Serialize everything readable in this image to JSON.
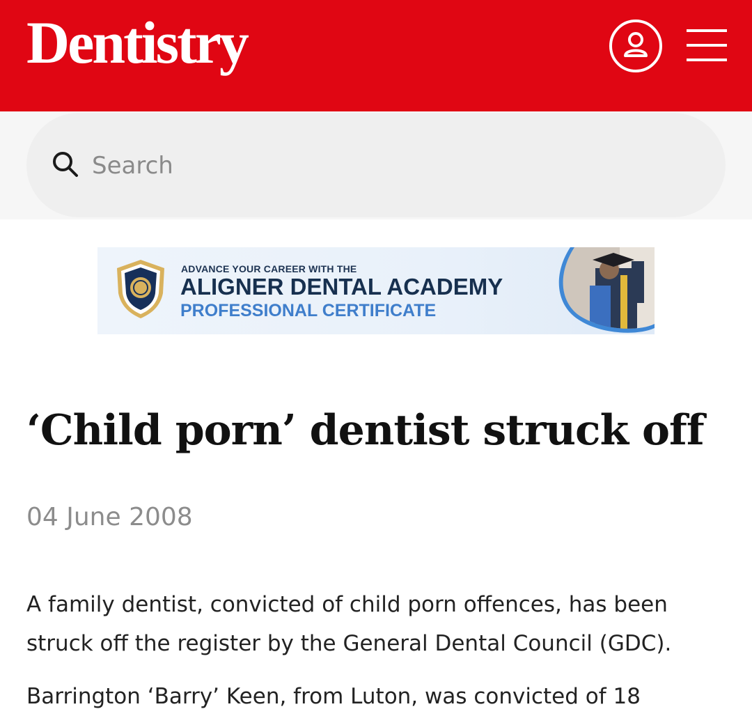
{
  "header": {
    "logo_text": "Dentistry",
    "brand_color": "#e00613",
    "account_icon": "user-icon",
    "menu_icon": "hamburger-menu-icon"
  },
  "search": {
    "placeholder": "Search",
    "icon": "search-icon"
  },
  "banner": {
    "line1": "ADVANCE YOUR CAREER WITH THE",
    "line2": "ALIGNER DENTAL ACADEMY",
    "line3": "PROFESSIONAL CERTIFICATE"
  },
  "article": {
    "title": "‘Child porn’ dentist struck off",
    "date": "04 June 2008",
    "paragraphs": [
      "A family dentist, convicted of child porn offences, has been struck off the register by the General Dental Council (GDC).",
      "Barrington ‘Barry’ Keen, from Luton, was convicted of 18"
    ]
  }
}
